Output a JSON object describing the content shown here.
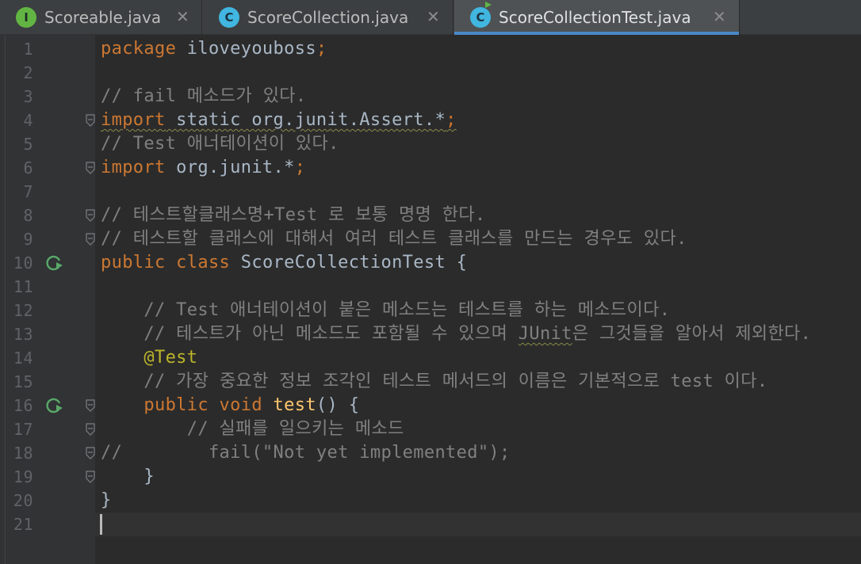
{
  "tabs": [
    {
      "icon": "interface-file-icon",
      "icon_letter": "I",
      "label": "Scoreable.java",
      "close": "✕",
      "active": false
    },
    {
      "icon": "class-file-icon",
      "icon_letter": "C",
      "label": "ScoreCollection.java",
      "close": "✕",
      "active": false
    },
    {
      "icon": "test-class-file-icon",
      "icon_letter": "C",
      "label": "ScoreCollectionTest.java",
      "close": "✕",
      "active": true
    }
  ],
  "editor": {
    "line_numbers": [
      "1",
      "2",
      "3",
      "4",
      "5",
      "6",
      "7",
      "8",
      "9",
      "10",
      "11",
      "12",
      "13",
      "14",
      "15",
      "16",
      "17",
      "18",
      "19",
      "20",
      "21"
    ],
    "lines": [
      [
        [
          "kw",
          "package"
        ],
        [
          "plain",
          " iloveyouboss"
        ],
        [
          "kw",
          ";"
        ]
      ],
      [],
      [
        [
          "cm",
          "// fail 메소드가 있다."
        ]
      ],
      [
        [
          "kw",
          "import"
        ],
        [
          "plain",
          " static org.junit.Assert.*"
        ],
        [
          "kw",
          ";"
        ]
      ],
      [
        [
          "cm",
          "// Test 애너테이션이 있다."
        ]
      ],
      [
        [
          "kw",
          "import"
        ],
        [
          "plain",
          " org.junit.*"
        ],
        [
          "kw",
          ";"
        ]
      ],
      [],
      [
        [
          "cm",
          "// 테스트할클래스명+Test 로 보통 명명 한다."
        ]
      ],
      [
        [
          "cm",
          "// 테스트할 클래스에 대해서 여러 테스트 클래스를 만드는 경우도 있다."
        ]
      ],
      [
        [
          "kw",
          "public class"
        ],
        [
          "plain",
          " ScoreCollectionTest {"
        ]
      ],
      [],
      [
        [
          "cm",
          "    // Test 애너테이션이 붙은 메소드는 테스트를 하는 메소드이다."
        ]
      ],
      [
        [
          "cm",
          "    // 테스트가 아닌 메소드도 포함될 수 있으며 "
        ],
        [
          "cm",
          "JUnit"
        ],
        [
          "cm",
          "은 그것들을 알아서 제외한다."
        ]
      ],
      [
        [
          "an",
          "    @Test"
        ]
      ],
      [
        [
          "cm",
          "    // 가장 중요한 정보 조각인 테스트 메서드의 이름은 기본적으로 test 이다."
        ]
      ],
      [
        [
          "kw",
          "    public void"
        ],
        [
          "fn",
          " test"
        ],
        [
          "plain",
          "() {"
        ]
      ],
      [
        [
          "cm",
          "        // 실패를 일으키는 메소드"
        ]
      ],
      [
        [
          "cm",
          "//        fail(\"Not yet implemented\");"
        ]
      ],
      [
        [
          "plain",
          "    }"
        ]
      ],
      [
        [
          "plain",
          "}"
        ]
      ],
      []
    ],
    "gutter_icons": {
      "run_lines": [
        10,
        16
      ],
      "fold_lines": [
        4,
        6,
        8,
        9,
        16,
        17,
        18,
        19
      ]
    },
    "caret_line": 21
  },
  "colors": {
    "keyword": "#cc7832",
    "comment": "#808080",
    "annotation": "#bbb529",
    "method": "#ffc66d",
    "text": "#a9b7c6",
    "background": "#2b2b2b",
    "tab_accent": "#4a88c7"
  }
}
